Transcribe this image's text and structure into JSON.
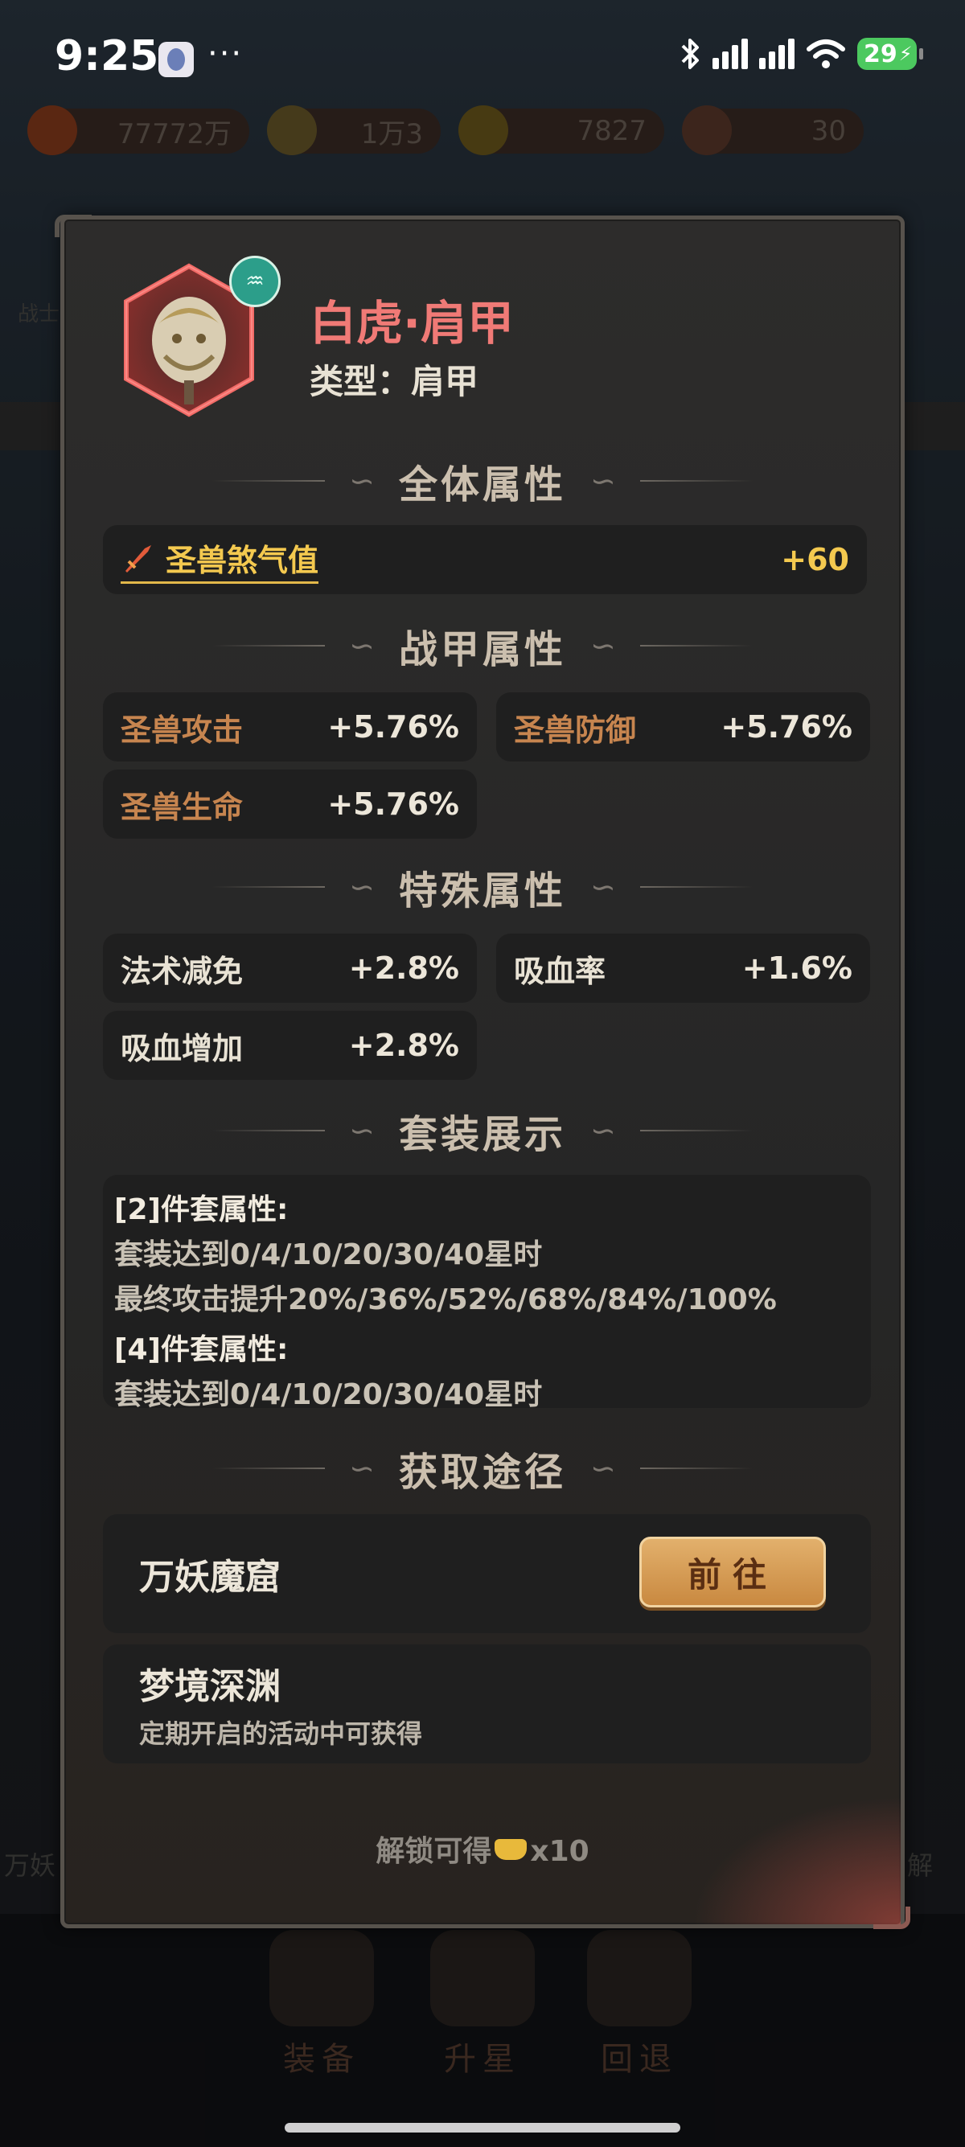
{
  "status_bar": {
    "time": "9:25",
    "more": "···",
    "battery": "29",
    "icons": [
      "bluetooth-icon",
      "signal-icon",
      "signal-icon",
      "wifi-icon",
      "battery-charging-icon"
    ]
  },
  "background": {
    "resources": [
      {
        "icon": "flame-icon",
        "value": "77772万"
      },
      {
        "icon": "coin-icon",
        "value": "1万3"
      },
      {
        "icon": "ticket-icon",
        "value": "7827"
      },
      {
        "icon": "crystal-icon",
        "value": "30"
      }
    ],
    "left_tab": "战士",
    "left_bottom": "万妖",
    "right_bottom": "解",
    "bottom_tabs": [
      "装备",
      "升星",
      "回退"
    ]
  },
  "item": {
    "name": "白虎·肩甲",
    "type_label": "类型：",
    "type_value": "肩甲"
  },
  "sections": {
    "overall": "全体属性",
    "armor": "战甲属性",
    "special": "特殊属性",
    "set": "套装展示",
    "source": "获取途径"
  },
  "overall_stat": {
    "label": "圣兽煞气值",
    "value": "+60",
    "icon": "sword-icon"
  },
  "armor_stats": [
    {
      "label": "圣兽攻击",
      "value": "+5.76%"
    },
    {
      "label": "圣兽防御",
      "value": "+5.76%"
    },
    {
      "label": "圣兽生命",
      "value": "+5.76%"
    }
  ],
  "special_stats": [
    {
      "label": "法术减免",
      "value": "+2.8%"
    },
    {
      "label": "吸血率",
      "value": "+1.6%"
    },
    {
      "label": "吸血增加",
      "value": "+2.8%"
    }
  ],
  "set_bonus": {
    "set2_header": "[2]件套属性:",
    "set2_line1": "套装达到0/4/10/20/30/40星时",
    "set2_line2": "最终攻击提升20%/36%/52%/68%/84%/100%",
    "set4_header": "[4]件套属性:",
    "set4_line1": "套装达到0/4/10/20/30/40星时"
  },
  "sources": [
    {
      "name": "万妖魔窟",
      "button": "前往"
    },
    {
      "name": "梦境深渊",
      "subtitle": "定期开启的活动中可获得"
    }
  ],
  "unlock": {
    "prefix": "解锁可得",
    "amount": "x10",
    "icon": "ingot-icon"
  },
  "colors": {
    "item_name": "#f07a76",
    "stat_gold": "#c7854f",
    "highlight": "#f4c94f",
    "button": "#c98940"
  }
}
